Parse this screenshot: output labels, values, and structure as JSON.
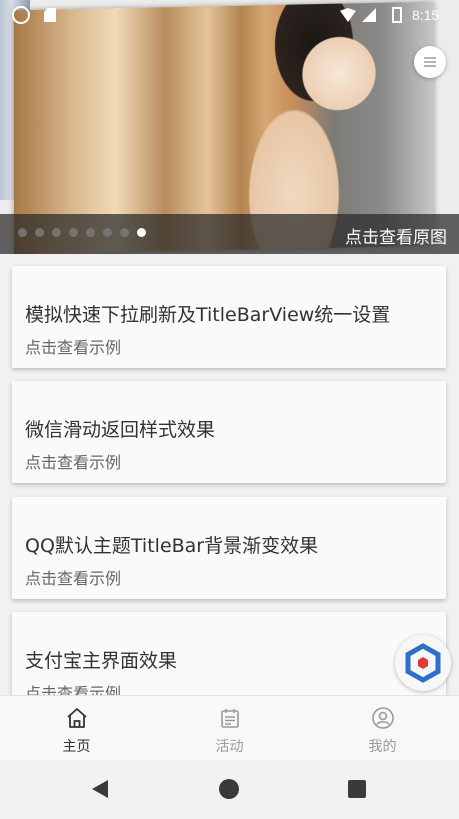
{
  "status_bar": {
    "time": "8:15"
  },
  "banner": {
    "caption": "点击查看原图",
    "dot_count": 8,
    "active_dot": 7
  },
  "cards": [
    {
      "title": "模拟快速下拉刷新及TitleBarView统一设置",
      "subtitle": "点击查看示例"
    },
    {
      "title": "微信滑动返回样式效果",
      "subtitle": "点击查看示例"
    },
    {
      "title": "QQ默认主题TitleBar背景渐变效果",
      "subtitle": "点击查看示例"
    },
    {
      "title": "支付宝主界面效果",
      "subtitle": "点击查看示例"
    }
  ],
  "bottom_nav": {
    "items": [
      {
        "label": "主页",
        "icon": "home-icon",
        "active": true
      },
      {
        "label": "活动",
        "icon": "calendar-icon",
        "active": false
      },
      {
        "label": "我的",
        "icon": "user-icon",
        "active": false
      }
    ]
  },
  "colors": {
    "active_tab": "#333333",
    "inactive_tab": "#9a9a9a",
    "card_bg": "#fafafa",
    "fab_blue": "#2d6fc9",
    "fab_red": "#e53935"
  }
}
